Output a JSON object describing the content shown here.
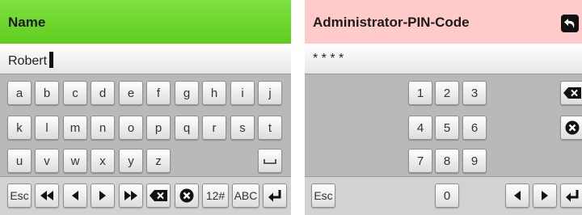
{
  "left": {
    "header": {
      "title": "Name",
      "color": "#66d12a"
    },
    "input": {
      "value": "Robert"
    },
    "keys": {
      "row1": [
        "a",
        "b",
        "c",
        "d",
        "e",
        "f",
        "g",
        "h",
        "i",
        "j"
      ],
      "row2": [
        "k",
        "l",
        "m",
        "n",
        "o",
        "p",
        "q",
        "r",
        "s",
        "t"
      ],
      "row3": [
        "u",
        "v",
        "w",
        "x",
        "y",
        "z"
      ],
      "bottom": {
        "esc": "Esc",
        "numbers": "12#",
        "abc": "ABC"
      }
    }
  },
  "right": {
    "header": {
      "title": "Administrator-PIN-Code",
      "color": "#ffcaca"
    },
    "input": {
      "value": "* * * *"
    },
    "numpad": [
      "1",
      "2",
      "3",
      "4",
      "5",
      "6",
      "7",
      "8",
      "9"
    ],
    "zero": "0",
    "bottom": {
      "esc": "Esc"
    }
  }
}
